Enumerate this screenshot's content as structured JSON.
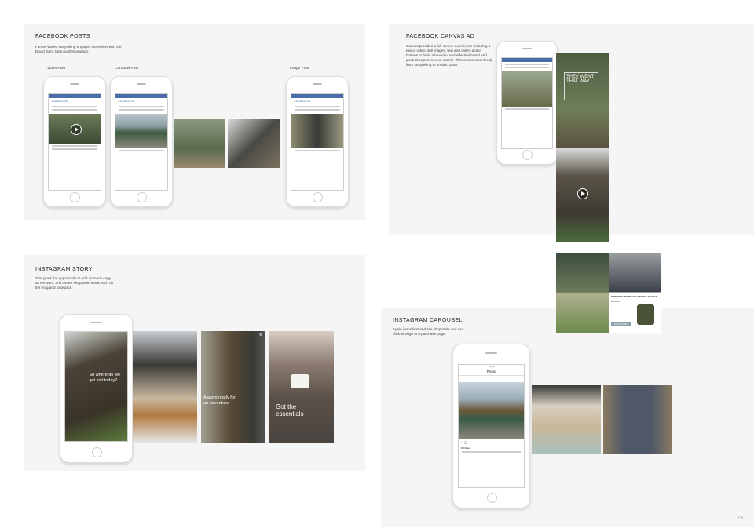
{
  "facebook_posts": {
    "title": "FACEBOOK POSTS",
    "desc": "Funnel-based storytelling engages the viewer with the brand story, then pushes product.",
    "labels": [
      "Video Post",
      "Carousel Post",
      "Image Post"
    ],
    "page_name": "Land Rover UK"
  },
  "canvas_ad": {
    "title": "FACEBOOK CANVAS AD",
    "desc": "Canvas provides a full-screen experience featuring a mix of video, still images, text and call-to-action buttons to build a beautiful and effective brand and product experience on mobile. This moves seamlessly from storytelling to product push.",
    "headline": "THEY WENT THAT WAY",
    "product": "WOMEN'S HERITAGE LEATHER JACKET",
    "price": "£380.00",
    "shop": "SHOP NOW"
  },
  "instagram_story": {
    "title": "INSTAGRAM STORY",
    "desc": "This gives the opportunity to add as much copy as we want, and create shoppable items such as the mug and backpack.",
    "captions": [
      "So where do we get lost today?",
      "Always ready for an adventure",
      "Got the essentials"
    ]
  },
  "instagram_carousel": {
    "title": "INSTAGRAM CAROUSEL",
    "desc": "Again items featured are shoppable and can click-through to a purchase page.",
    "time": "14:30",
    "screen_title": "Photo",
    "likes": "150 likes"
  },
  "page_number": "73"
}
